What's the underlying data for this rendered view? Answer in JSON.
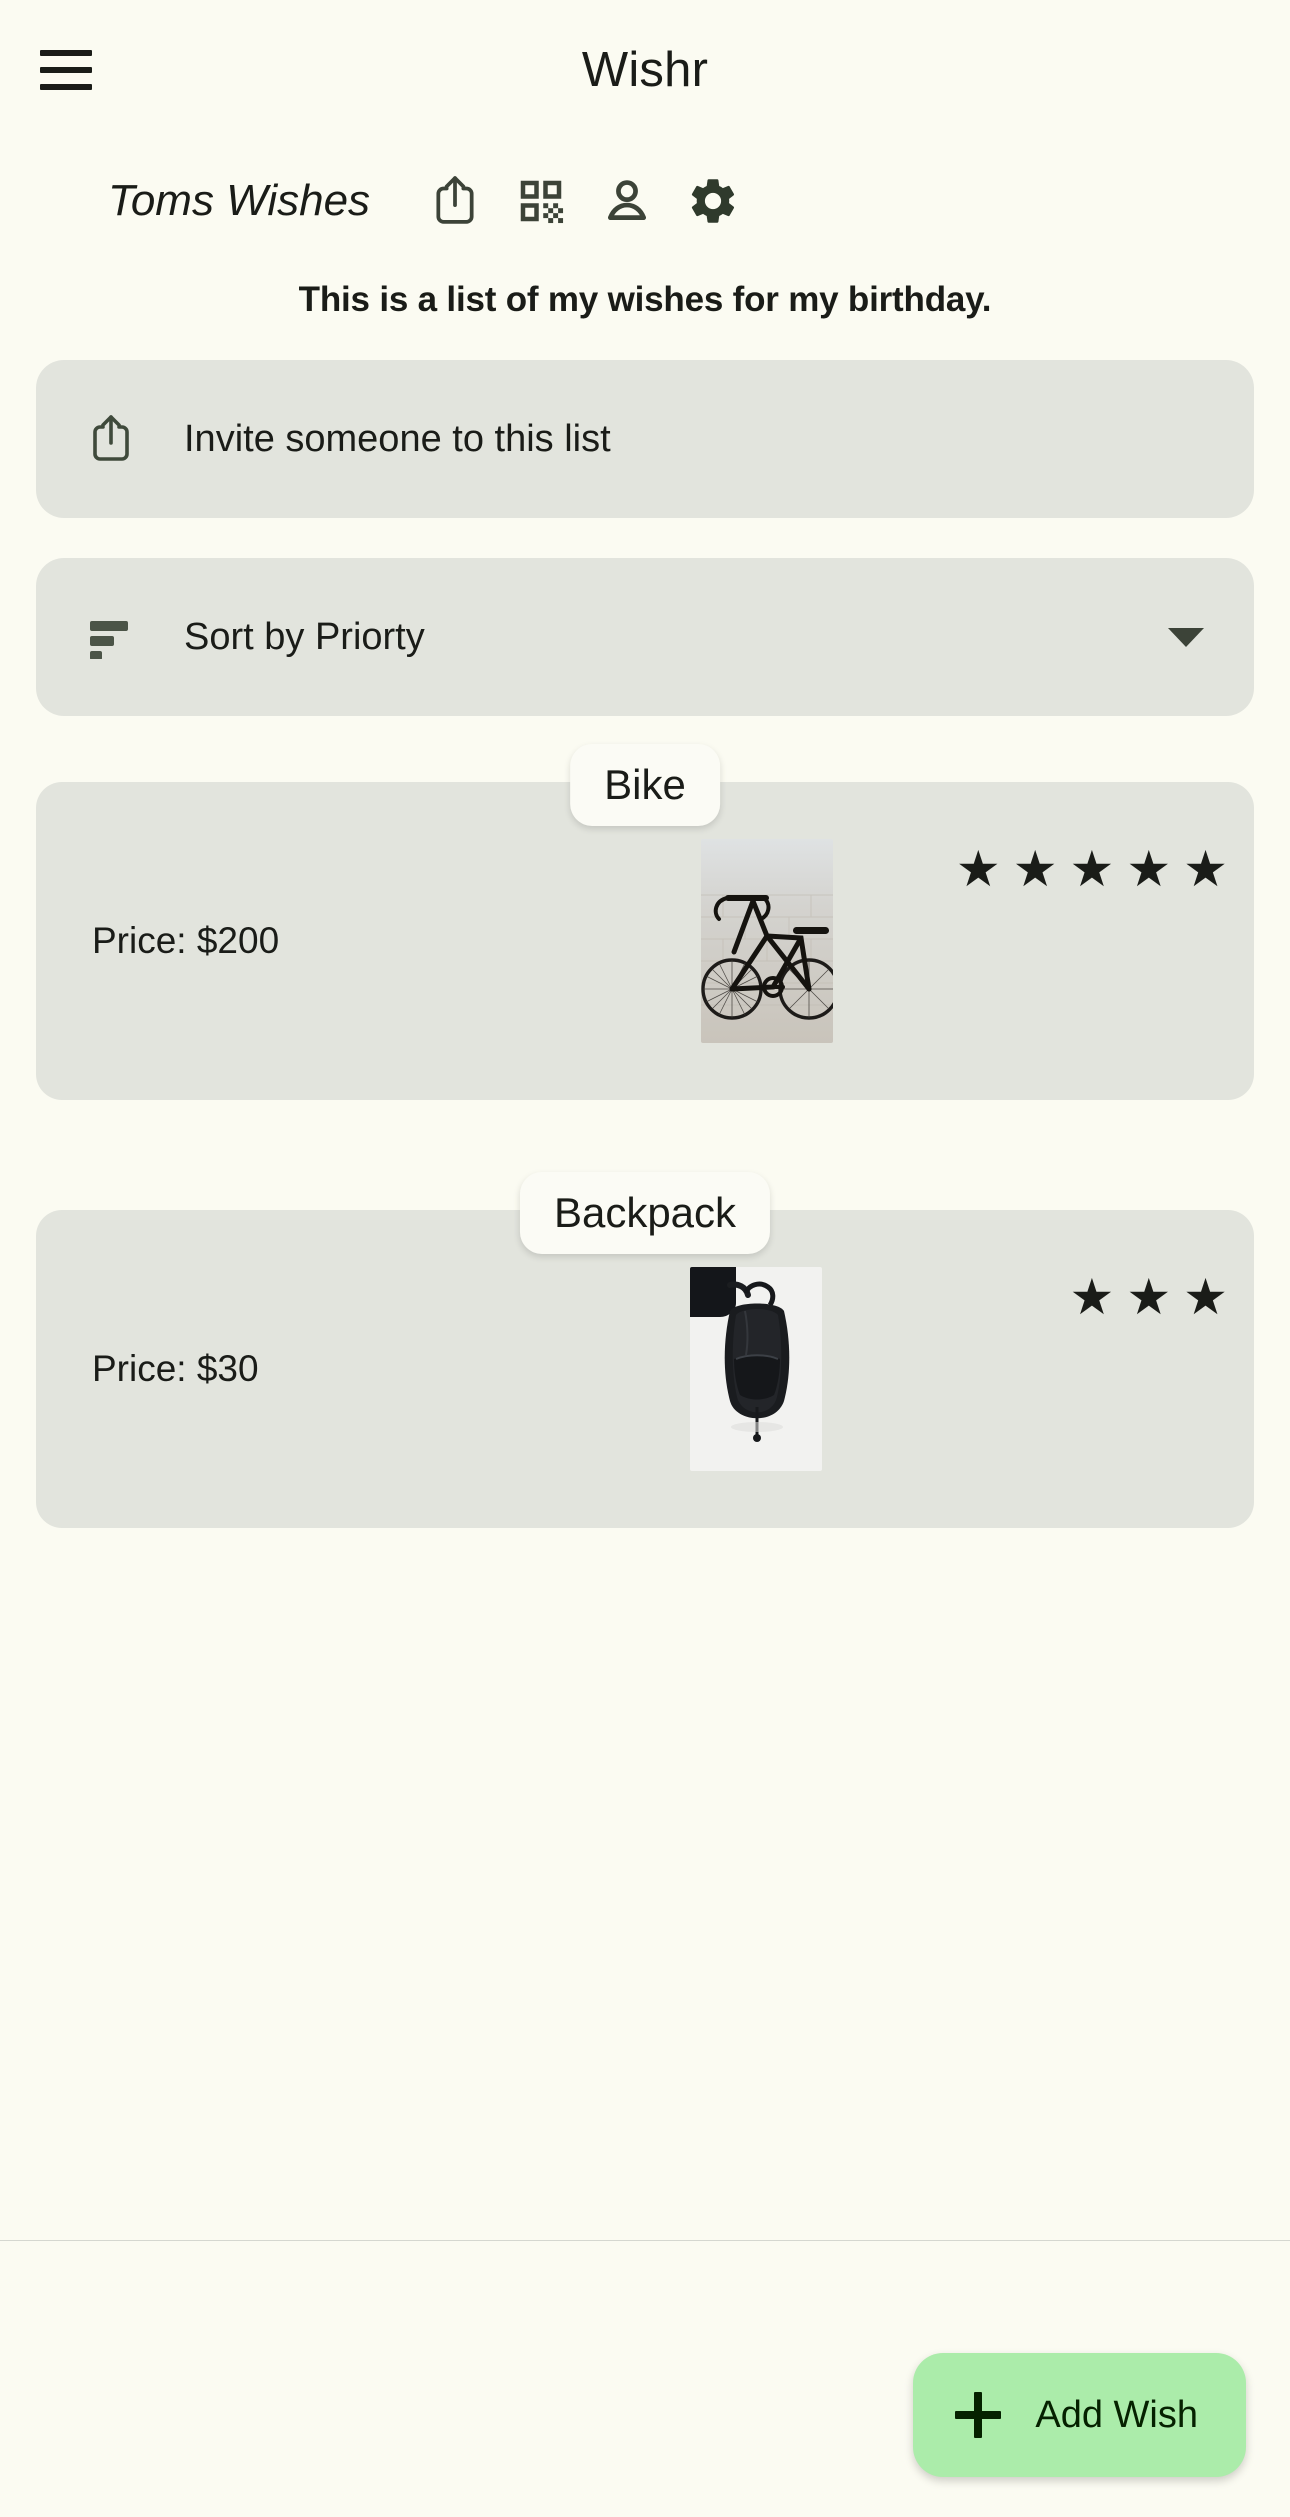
{
  "app": {
    "title": "Wishr",
    "menu_icon": "hamburger-menu-icon",
    "background_color": "#fbfbf2"
  },
  "list_header": {
    "list_name": "Toms Wishes",
    "actions": [
      {
        "name": "share-icon",
        "label": "Share"
      },
      {
        "name": "qr-code-icon",
        "label": "QR Code"
      },
      {
        "name": "person-icon",
        "label": "Account"
      },
      {
        "name": "gear-icon",
        "label": "Settings"
      }
    ]
  },
  "description": "This is a list of my wishes for my birthday.",
  "invite_row": {
    "icon": "share-icon",
    "label": "Invite someone to this list"
  },
  "sort_row": {
    "icon": "sort-icon",
    "label": "Sort by Priorty",
    "caret": "chevron-down-icon"
  },
  "wishes": [
    {
      "title": "Bike",
      "price_label": "Price: $200",
      "price": 200,
      "currency": "$",
      "rating": 5,
      "image": "bicycle-photo"
    },
    {
      "title": "Backpack",
      "price_label": "Price: $30",
      "price": 30,
      "currency": "$",
      "rating": 3,
      "image": "backpack-photo"
    }
  ],
  "add_button": {
    "label": "Add Wish",
    "icon": "plus-icon",
    "color": "#abecaa"
  },
  "colors": {
    "background": "#fbfbf2",
    "surface": "#e2e4dd",
    "chip": "#fbfbf5",
    "accent": "#abecaa",
    "text": "#1a1c18"
  }
}
